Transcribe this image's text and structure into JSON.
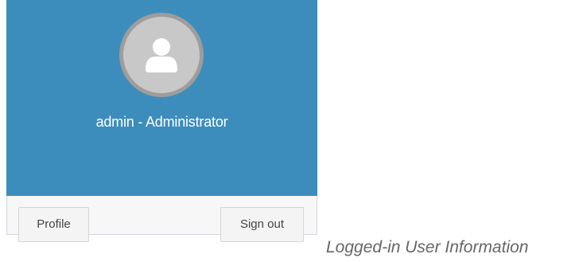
{
  "user": {
    "display_name": "admin - Administrator",
    "avatar_icon": "user-silhouette-icon"
  },
  "footer": {
    "profile_label": "Profile",
    "signout_label": "Sign out"
  },
  "caption": "Logged-in User Information",
  "colors": {
    "header_bg": "#3c8dbc",
    "avatar_bg": "#c8c8c8",
    "avatar_border": "#9d9d9d",
    "footer_bg": "#f7f7f7"
  }
}
